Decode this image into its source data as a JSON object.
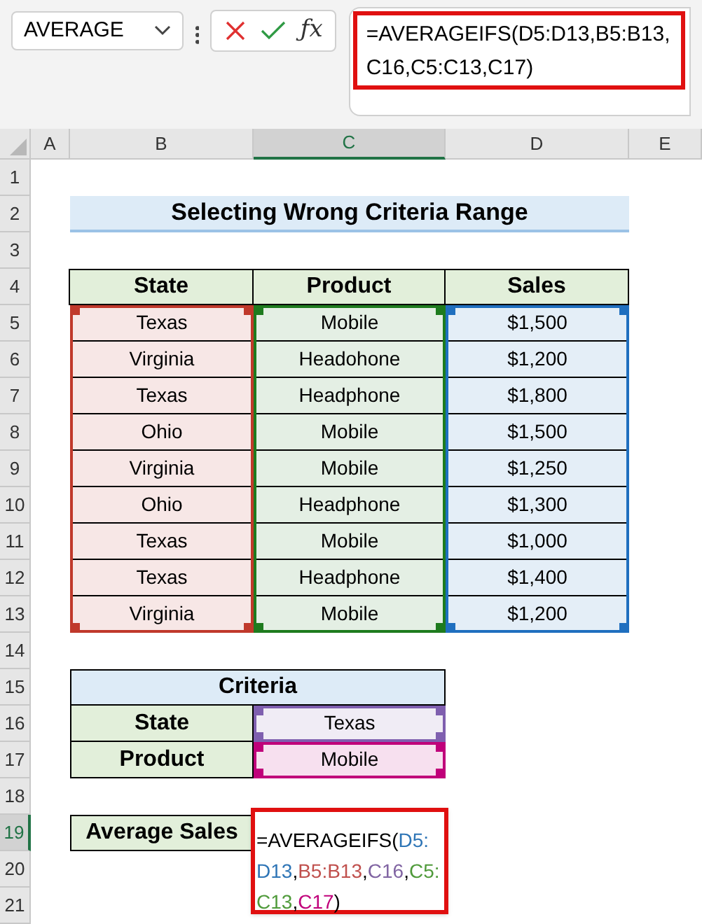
{
  "name_box": {
    "value": "AVERAGE"
  },
  "function_button": {
    "label": "ƒx"
  },
  "formula_bar": {
    "lines": [
      "=AVERAGEIFS(D5:D13,B5:B13,",
      "C16,C5:C13,C17)"
    ]
  },
  "column_headers": [
    {
      "label": "A",
      "selected": false
    },
    {
      "label": "B",
      "selected": false
    },
    {
      "label": "C",
      "selected": true
    },
    {
      "label": "D",
      "selected": false
    },
    {
      "label": "E",
      "selected": false
    }
  ],
  "row_headers": [
    {
      "label": "1",
      "selected": false
    },
    {
      "label": "2",
      "selected": false
    },
    {
      "label": "3",
      "selected": false
    },
    {
      "label": "4",
      "selected": false
    },
    {
      "label": "5",
      "selected": false
    },
    {
      "label": "6",
      "selected": false
    },
    {
      "label": "7",
      "selected": false
    },
    {
      "label": "8",
      "selected": false
    },
    {
      "label": "9",
      "selected": false
    },
    {
      "label": "10",
      "selected": false
    },
    {
      "label": "11",
      "selected": false
    },
    {
      "label": "12",
      "selected": false
    },
    {
      "label": "13",
      "selected": false
    },
    {
      "label": "14",
      "selected": false
    },
    {
      "label": "15",
      "selected": false
    },
    {
      "label": "16",
      "selected": false
    },
    {
      "label": "17",
      "selected": false
    },
    {
      "label": "18",
      "selected": false
    },
    {
      "label": "19",
      "selected": true
    },
    {
      "label": "20",
      "selected": false
    },
    {
      "label": "21",
      "selected": false
    }
  ],
  "title": "Selecting Wrong Criteria Range",
  "sales_table": {
    "columns": [
      {
        "label": "State",
        "color": "#c0392b"
      },
      {
        "label": "Product",
        "color": "#1e7b1e"
      },
      {
        "label": "Sales",
        "color": "#1f6fbf"
      }
    ],
    "rows": [
      [
        "Texas",
        "Mobile",
        "$1,500"
      ],
      [
        "Virginia",
        "Headohone",
        "$1,200"
      ],
      [
        "Texas",
        "Headphone",
        "$1,800"
      ],
      [
        "Ohio",
        "Mobile",
        "$1,500"
      ],
      [
        "Virginia",
        "Mobile",
        "$1,250"
      ],
      [
        "Ohio",
        "Headphone",
        "$1,300"
      ],
      [
        "Texas",
        "Mobile",
        "$1,000"
      ],
      [
        "Texas",
        "Headphone",
        "$1,400"
      ],
      [
        "Virginia",
        "Mobile",
        "$1,200"
      ]
    ]
  },
  "criteria": {
    "title": "Criteria",
    "rows": [
      {
        "label": "State",
        "value": "Texas",
        "color": "#7f5faf"
      },
      {
        "label": "Product",
        "value": "Mobile",
        "color": "#c0007a"
      }
    ]
  },
  "average": {
    "label": "Average Sales",
    "formula_lines": [
      [
        {
          "text": "=AVERAGEIFS(",
          "color": "#000000"
        },
        {
          "text": "D5:",
          "color": "#2e75b6"
        }
      ],
      [
        {
          "text": "D13",
          "color": "#2e75b6",
          "suffix": ","
        },
        {
          "text": "B5:B13",
          "color": "#c0504d",
          "suffix": ","
        },
        {
          "text": "C16",
          "color": "#8064a2",
          "suffix": ","
        },
        {
          "text": "C5:",
          "color": "#4f9a3a"
        }
      ],
      [
        {
          "text": "C13",
          "color": "#4f9a3a",
          "suffix": ","
        },
        {
          "text": "C17",
          "color": "#c0007a",
          "suffix": ")"
        }
      ]
    ]
  }
}
